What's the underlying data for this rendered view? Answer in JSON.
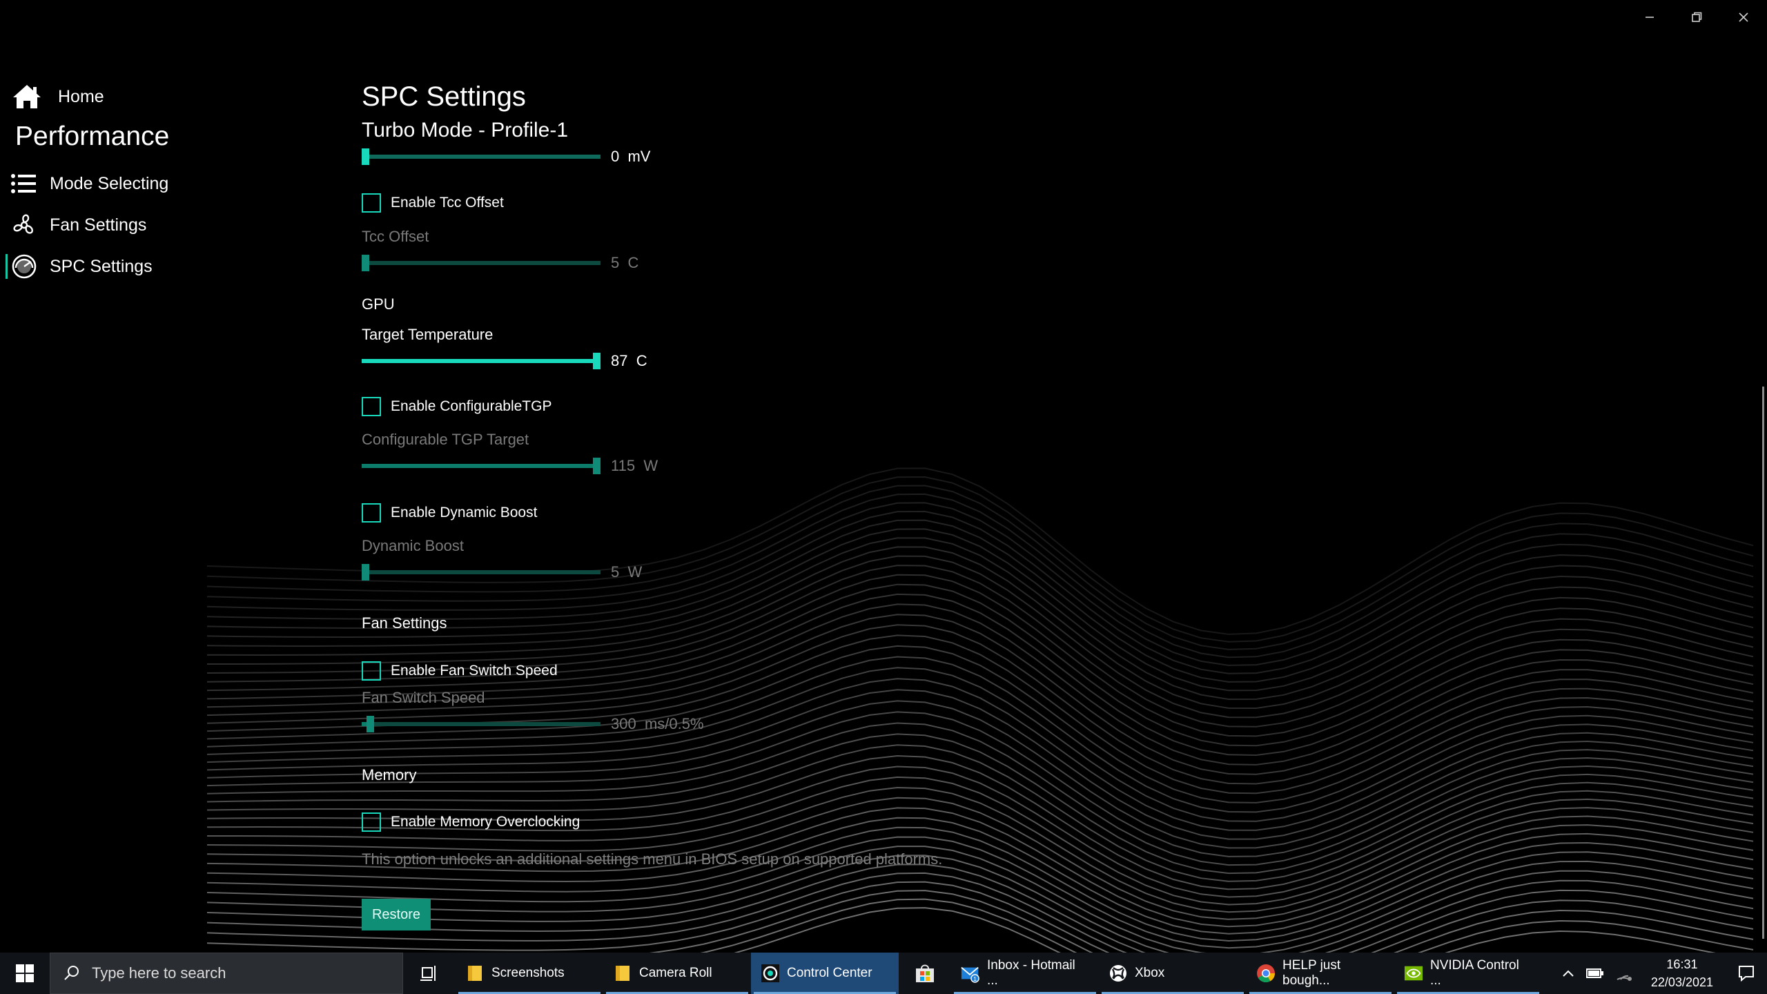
{
  "window": {
    "controls": [
      "minimize",
      "restore",
      "close"
    ]
  },
  "sidebar": {
    "home_label": "Home",
    "section": "Performance",
    "items": [
      {
        "label": "Mode Selecting",
        "icon": "list-icon"
      },
      {
        "label": "Fan Settings",
        "icon": "fan-icon"
      },
      {
        "label": "SPC Settings",
        "icon": "gauge-icon"
      }
    ],
    "active": "SPC Settings"
  },
  "main": {
    "title": "SPC Settings",
    "profile": "Turbo Mode - Profile-1",
    "voltage": {
      "value": "0",
      "unit": "mV",
      "level": 0.0
    },
    "tcc": {
      "checkbox": "Enable Tcc Offset",
      "checked": false,
      "label": "Tcc Offset",
      "value": "5",
      "unit": "C",
      "level": 0.0
    },
    "gpu": {
      "heading": "GPU",
      "target_label": "Target Temperature",
      "target_value": "87",
      "target_unit": "C",
      "target_level": 1.0,
      "ctgp_checkbox": "Enable ConfigurableTGP",
      "ctgp_checked": false,
      "ctgp_label": "Configurable TGP Target",
      "ctgp_value": "115",
      "ctgp_unit": "W",
      "ctgp_level": 1.0,
      "boost_checkbox": "Enable Dynamic Boost",
      "boost_checked": false,
      "boost_label": "Dynamic Boost",
      "boost_value": "5",
      "boost_unit": "W",
      "boost_level": 0.0
    },
    "fan": {
      "heading": "Fan Settings",
      "checkbox": "Enable Fan Switch Speed",
      "checked": false,
      "label": "Fan Switch Speed",
      "value": "300",
      "unit": "ms/0.5%",
      "level": 0.02
    },
    "memory": {
      "heading": "Memory",
      "checkbox": "Enable Memory Overclocking",
      "checked": false,
      "info": "This option unlocks an additional settings menu in BIOS setup on supported platforms."
    },
    "restore_label": "Restore"
  },
  "taskbar": {
    "search_placeholder": "Type here to search",
    "apps": [
      {
        "label": "Screenshots",
        "icon": "folder-icon"
      },
      {
        "label": "Camera Roll",
        "icon": "folder-icon"
      },
      {
        "label": "Control Center",
        "icon": "control-center-icon",
        "active": true
      },
      {
        "label": "",
        "icon": "store-icon"
      },
      {
        "label": "Inbox - Hotmail ...",
        "icon": "mail-icon",
        "badge": "1"
      },
      {
        "label": "Xbox",
        "icon": "xbox-icon"
      },
      {
        "label": "HELP just bough...",
        "icon": "chrome-icon"
      },
      {
        "label": "NVIDIA Control ...",
        "icon": "nvidia-icon"
      }
    ],
    "time": "16:31",
    "date": "22/03/2021"
  },
  "colors": {
    "accent": "#18d9bc",
    "accent_dim": "#0f8b77",
    "background": "#000000",
    "restore_button": "#0f8f75",
    "taskbar": "#101418",
    "active_task": "#1f4a78"
  }
}
